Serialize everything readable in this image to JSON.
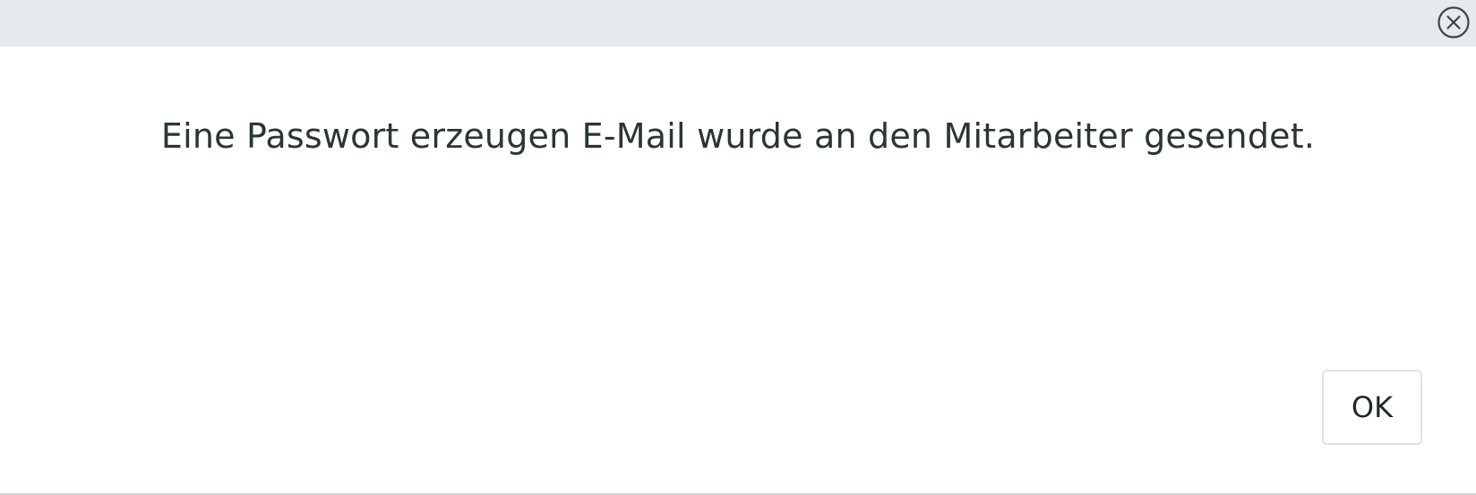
{
  "dialog": {
    "close_icon": "close-circle-icon",
    "message": "Eine Passwort erzeugen E-Mail wurde an den Mitarbeiter gesendet.",
    "ok_label": "OK"
  },
  "colors": {
    "header_bg": "#e7eaed",
    "text": "#2a3633",
    "button_border": "#dde1e4"
  }
}
